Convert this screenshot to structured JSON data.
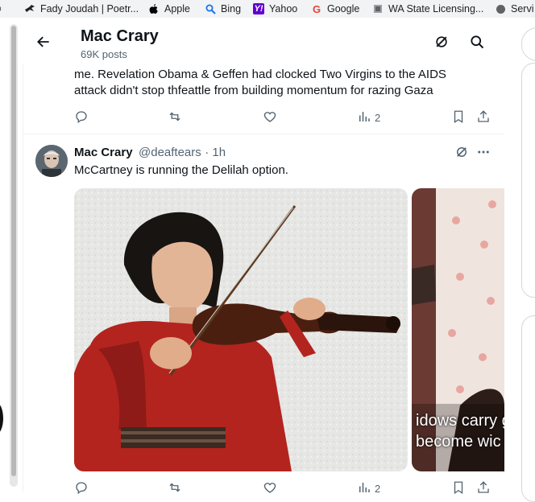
{
  "bookmarks": [
    {
      "label": "Fady Joudah | Poetr...",
      "icon": "bird-icon"
    },
    {
      "label": "Apple",
      "icon": "apple-icon"
    },
    {
      "label": "Bing",
      "icon": "bing-search-icon"
    },
    {
      "label": "Yahoo",
      "icon": "yahoo-icon"
    },
    {
      "label": "Google",
      "icon": "google-icon"
    },
    {
      "label": "WA State Licensing...",
      "icon": "licensing-icon"
    },
    {
      "label": "Servi",
      "icon": "globe-icon"
    }
  ],
  "header": {
    "title": "Mac Crary",
    "subtitle": "69K posts"
  },
  "previous_post": {
    "line1": "me.  Revelation Obama & Geffen had clocked Two Virgins to the AIDS",
    "line2": "attack didn't stop thfeattle from building momentum for razing Gaza",
    "views": "2"
  },
  "post": {
    "author_name": "Mac Crary",
    "handle": "@deaftears",
    "time": "1h",
    "text": "McCartney is running the Delilah option.",
    "media2_caption_line1": "idows carry g",
    "media2_caption_line2": "become wic",
    "views": "2"
  },
  "colors": {
    "text_primary": "#0f1419",
    "text_secondary": "#536471",
    "divider": "#eff3f4",
    "violin_dress": "#b3241f"
  }
}
